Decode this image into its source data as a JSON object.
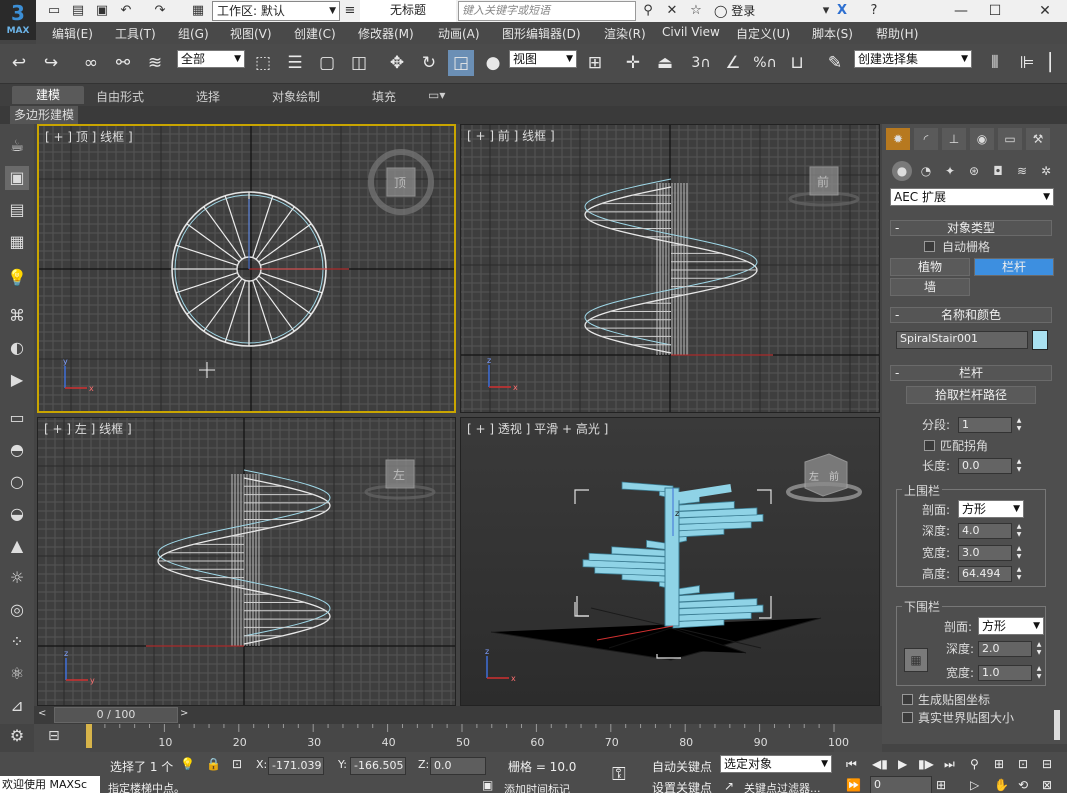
{
  "app": {
    "logo_text": "MAX",
    "doc_title": "无标题",
    "workspace_label": "工作区: 默认",
    "search_placeholder": "键入关键字或短语",
    "login": "登录"
  },
  "menu": [
    "编辑(E)",
    "工具(T)",
    "组(G)",
    "视图(V)",
    "创建(C)",
    "修改器(M)",
    "动画(A)",
    "图形编辑器(D)",
    "渲染(R)",
    "Civil View",
    "自定义(U)",
    "脚本(S)",
    "帮助(H)"
  ],
  "toolbar": {
    "filter": "全部",
    "refcoord": "视图",
    "named_selection": "创建选择集",
    "snap_label": "3",
    "percent_label": "%"
  },
  "ribbon": {
    "tabs": [
      "建模",
      "自由形式",
      "选择",
      "对象绘制",
      "填充"
    ],
    "sub": "多边形建模"
  },
  "viewports": {
    "top": "[ + ] 顶 ] 线框 ]",
    "front": "[ + ] 前 ] 线框 ]",
    "left": "[ + ] 左 ] 线框 ]",
    "persp": "[ + ] 透视 ] 平滑 + 高光 ]",
    "cube_top": "顶",
    "cube_front": "前",
    "cube_left": "左",
    "cube_persp_l": "左",
    "cube_persp_r": "前"
  },
  "panel": {
    "category": "AEC 扩展",
    "object_type": "对象类型",
    "autogrid": "自动栅格",
    "plants": "植物",
    "railing": "栏杆",
    "wall": "墙",
    "name_color": "名称和颜色",
    "object_name": "SpiralStair001",
    "name_color_hex": "#a9e0f0",
    "railing_rollout": "栏杆",
    "pick_path": "拾取栏杆路径",
    "segments_label": "分段:",
    "segments": "1",
    "match_corners": "匹配拐角",
    "length_label": "长度:",
    "length": "0.0",
    "top_rail": "上围栏",
    "profile_label": "剖面:",
    "top_profile": "方形",
    "depth_label": "深度:",
    "top_depth": "4.0",
    "width_label": "宽度:",
    "top_width": "3.0",
    "height_label": "高度:",
    "top_height": "64.494",
    "bottom_rail": "下围栏",
    "bottom_profile": "方形",
    "bottom_depth": "2.0",
    "bottom_width": "1.0",
    "gen_mapping": "生成贴图坐标",
    "real_world": "真实世界贴图大小"
  },
  "timeline": {
    "frame": "0 / 100",
    "ticks": [
      "10",
      "20",
      "30",
      "40",
      "50",
      "60",
      "70",
      "80",
      "90",
      "100"
    ]
  },
  "status": {
    "welcome": "欢迎使用 MAXSc",
    "selected": "选择了 1 个",
    "prompt": "指定楼梯中点。",
    "x_label": "X:",
    "x": "-171.039",
    "y_label": "Y:",
    "y": "-166.505",
    "z_label": "Z:",
    "z": "0.0",
    "grid": "栅格 = 10.0",
    "add_time_tag": "添加时间标记",
    "auto_key": "自动关键点",
    "set_key": "设置关键点",
    "sel_obj": "选定对象",
    "key_filter": "关键点过滤器...",
    "frame_field": "0"
  },
  "colors": {
    "accent": "#3d8fe0",
    "stair": "#8fd3e6",
    "grid_bg": "#3b3b3b",
    "active_border": "#c9a500"
  }
}
